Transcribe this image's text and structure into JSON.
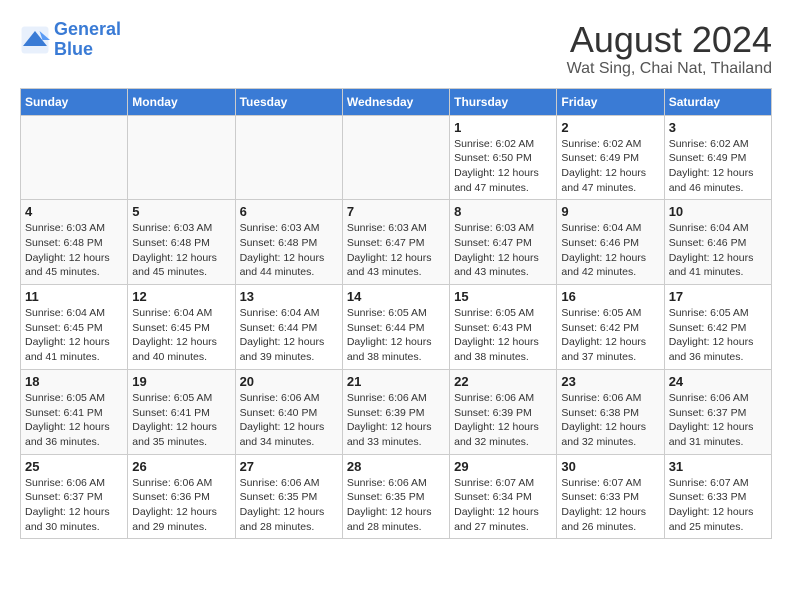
{
  "header": {
    "logo_line1": "General",
    "logo_line2": "Blue",
    "title": "August 2024",
    "subtitle": "Wat Sing, Chai Nat, Thailand"
  },
  "weekdays": [
    "Sunday",
    "Monday",
    "Tuesday",
    "Wednesday",
    "Thursday",
    "Friday",
    "Saturday"
  ],
  "weeks": [
    [
      {
        "day": "",
        "info": ""
      },
      {
        "day": "",
        "info": ""
      },
      {
        "day": "",
        "info": ""
      },
      {
        "day": "",
        "info": ""
      },
      {
        "day": "1",
        "info": "Sunrise: 6:02 AM\nSunset: 6:50 PM\nDaylight: 12 hours\nand 47 minutes."
      },
      {
        "day": "2",
        "info": "Sunrise: 6:02 AM\nSunset: 6:49 PM\nDaylight: 12 hours\nand 47 minutes."
      },
      {
        "day": "3",
        "info": "Sunrise: 6:02 AM\nSunset: 6:49 PM\nDaylight: 12 hours\nand 46 minutes."
      }
    ],
    [
      {
        "day": "4",
        "info": "Sunrise: 6:03 AM\nSunset: 6:48 PM\nDaylight: 12 hours\nand 45 minutes."
      },
      {
        "day": "5",
        "info": "Sunrise: 6:03 AM\nSunset: 6:48 PM\nDaylight: 12 hours\nand 45 minutes."
      },
      {
        "day": "6",
        "info": "Sunrise: 6:03 AM\nSunset: 6:48 PM\nDaylight: 12 hours\nand 44 minutes."
      },
      {
        "day": "7",
        "info": "Sunrise: 6:03 AM\nSunset: 6:47 PM\nDaylight: 12 hours\nand 43 minutes."
      },
      {
        "day": "8",
        "info": "Sunrise: 6:03 AM\nSunset: 6:47 PM\nDaylight: 12 hours\nand 43 minutes."
      },
      {
        "day": "9",
        "info": "Sunrise: 6:04 AM\nSunset: 6:46 PM\nDaylight: 12 hours\nand 42 minutes."
      },
      {
        "day": "10",
        "info": "Sunrise: 6:04 AM\nSunset: 6:46 PM\nDaylight: 12 hours\nand 41 minutes."
      }
    ],
    [
      {
        "day": "11",
        "info": "Sunrise: 6:04 AM\nSunset: 6:45 PM\nDaylight: 12 hours\nand 41 minutes."
      },
      {
        "day": "12",
        "info": "Sunrise: 6:04 AM\nSunset: 6:45 PM\nDaylight: 12 hours\nand 40 minutes."
      },
      {
        "day": "13",
        "info": "Sunrise: 6:04 AM\nSunset: 6:44 PM\nDaylight: 12 hours\nand 39 minutes."
      },
      {
        "day": "14",
        "info": "Sunrise: 6:05 AM\nSunset: 6:44 PM\nDaylight: 12 hours\nand 38 minutes."
      },
      {
        "day": "15",
        "info": "Sunrise: 6:05 AM\nSunset: 6:43 PM\nDaylight: 12 hours\nand 38 minutes."
      },
      {
        "day": "16",
        "info": "Sunrise: 6:05 AM\nSunset: 6:42 PM\nDaylight: 12 hours\nand 37 minutes."
      },
      {
        "day": "17",
        "info": "Sunrise: 6:05 AM\nSunset: 6:42 PM\nDaylight: 12 hours\nand 36 minutes."
      }
    ],
    [
      {
        "day": "18",
        "info": "Sunrise: 6:05 AM\nSunset: 6:41 PM\nDaylight: 12 hours\nand 36 minutes."
      },
      {
        "day": "19",
        "info": "Sunrise: 6:05 AM\nSunset: 6:41 PM\nDaylight: 12 hours\nand 35 minutes."
      },
      {
        "day": "20",
        "info": "Sunrise: 6:06 AM\nSunset: 6:40 PM\nDaylight: 12 hours\nand 34 minutes."
      },
      {
        "day": "21",
        "info": "Sunrise: 6:06 AM\nSunset: 6:39 PM\nDaylight: 12 hours\nand 33 minutes."
      },
      {
        "day": "22",
        "info": "Sunrise: 6:06 AM\nSunset: 6:39 PM\nDaylight: 12 hours\nand 32 minutes."
      },
      {
        "day": "23",
        "info": "Sunrise: 6:06 AM\nSunset: 6:38 PM\nDaylight: 12 hours\nand 32 minutes."
      },
      {
        "day": "24",
        "info": "Sunrise: 6:06 AM\nSunset: 6:37 PM\nDaylight: 12 hours\nand 31 minutes."
      }
    ],
    [
      {
        "day": "25",
        "info": "Sunrise: 6:06 AM\nSunset: 6:37 PM\nDaylight: 12 hours\nand 30 minutes."
      },
      {
        "day": "26",
        "info": "Sunrise: 6:06 AM\nSunset: 6:36 PM\nDaylight: 12 hours\nand 29 minutes."
      },
      {
        "day": "27",
        "info": "Sunrise: 6:06 AM\nSunset: 6:35 PM\nDaylight: 12 hours\nand 28 minutes."
      },
      {
        "day": "28",
        "info": "Sunrise: 6:06 AM\nSunset: 6:35 PM\nDaylight: 12 hours\nand 28 minutes."
      },
      {
        "day": "29",
        "info": "Sunrise: 6:07 AM\nSunset: 6:34 PM\nDaylight: 12 hours\nand 27 minutes."
      },
      {
        "day": "30",
        "info": "Sunrise: 6:07 AM\nSunset: 6:33 PM\nDaylight: 12 hours\nand 26 minutes."
      },
      {
        "day": "31",
        "info": "Sunrise: 6:07 AM\nSunset: 6:33 PM\nDaylight: 12 hours\nand 25 minutes."
      }
    ]
  ]
}
